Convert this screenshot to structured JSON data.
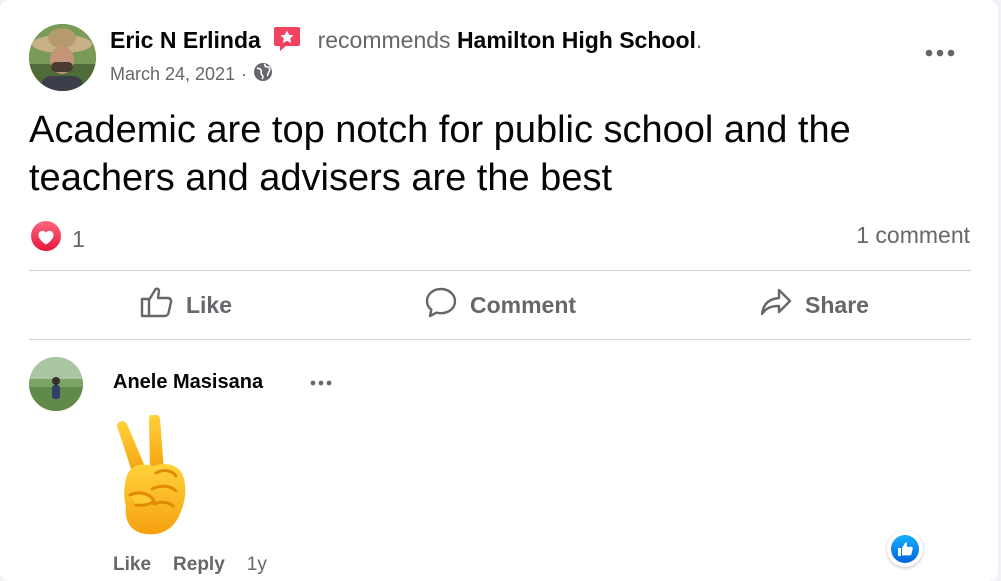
{
  "post": {
    "author": "Eric N Erlinda",
    "verb": "recommends",
    "page": "Hamilton High School",
    "page_suffix": ".",
    "date": "March 24, 2021",
    "date_separator": "·",
    "privacy_icon": "globe-icon",
    "text": "Academic are top notch for public school and the teachers and advisers are the best"
  },
  "reactions": {
    "icon": "love-reaction-icon",
    "count": "1",
    "comments": "1 comment"
  },
  "actions": {
    "like": "Like",
    "comment": "Comment",
    "share": "Share"
  },
  "comment": {
    "author": "Anele Masisana",
    "emoji": "✌",
    "like": "Like",
    "reply": "Reply",
    "age": "1y",
    "reaction_icon": "like-reaction-icon"
  },
  "colors": {
    "secondary_text": "#65676b",
    "divider": "#ced0d4",
    "love": "#f33e58",
    "like_blue": "#1877f2",
    "recommend_badge": "#f3425f"
  }
}
